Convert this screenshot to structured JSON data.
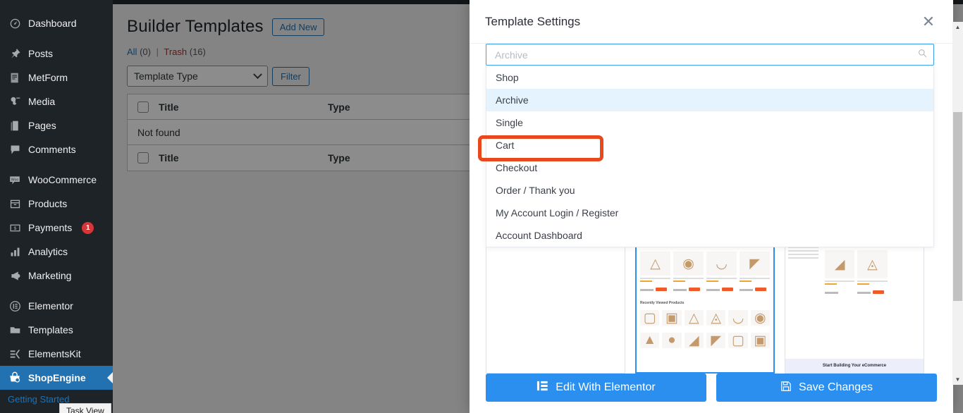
{
  "sidebar": {
    "items": [
      {
        "label": "Dashboard",
        "icon": "dashboard-icon",
        "gap_after": true
      },
      {
        "label": "Posts",
        "icon": "pin-icon",
        "gap_after": false
      },
      {
        "label": "MetForm",
        "icon": "form-icon",
        "gap_after": false
      },
      {
        "label": "Media",
        "icon": "media-icon",
        "gap_after": false
      },
      {
        "label": "Pages",
        "icon": "pages-icon",
        "gap_after": false
      },
      {
        "label": "Comments",
        "icon": "comment-icon",
        "gap_after": true
      },
      {
        "label": "WooCommerce",
        "icon": "woo-icon",
        "gap_after": false
      },
      {
        "label": "Products",
        "icon": "products-icon",
        "gap_after": false
      },
      {
        "label": "Payments",
        "icon": "payments-icon",
        "badge": "1",
        "gap_after": false
      },
      {
        "label": "Analytics",
        "icon": "analytics-icon",
        "gap_after": false
      },
      {
        "label": "Marketing",
        "icon": "marketing-icon",
        "gap_after": true
      },
      {
        "label": "Elementor",
        "icon": "elementor-icon",
        "gap_after": false
      },
      {
        "label": "Templates",
        "icon": "templates-icon",
        "gap_after": false
      },
      {
        "label": "ElementsKit",
        "icon": "elementskit-icon",
        "gap_after": false
      },
      {
        "label": "ShopEngine",
        "icon": "shopengine-icon",
        "active": true,
        "gap_after": false
      }
    ],
    "submenu_label": "Getting Started"
  },
  "taskview_tooltip": "Task View",
  "page": {
    "title": "Builder Templates",
    "add_new_label": "Add New",
    "views": {
      "all_label": "All",
      "all_count": "(0)",
      "separator": "|",
      "trash_label": "Trash",
      "trash_count": "(16)"
    },
    "filter": {
      "select_value": "Template Type",
      "button_label": "Filter"
    },
    "table": {
      "columns": {
        "title": "Title",
        "type": "Type"
      },
      "empty_message": "Not found"
    }
  },
  "modal": {
    "title": "Template Settings",
    "close_label": "✕",
    "search": {
      "value": "",
      "placeholder": "Archive"
    },
    "dropdown": {
      "options": [
        "Shop",
        "Archive",
        "Single",
        "Cart",
        "Checkout",
        "Order / Thank you",
        "My Account Login / Register",
        "Account Dashboard"
      ],
      "selected": "Archive"
    },
    "footer": {
      "edit_label": "Edit With Elementor",
      "save_label": "Save Changes"
    }
  },
  "colors": {
    "accent_blue": "#2a8fef",
    "wp_blue": "#2271b1",
    "sidebar_bg": "#1d2327",
    "annotation_orange": "#e8491c",
    "highlight_row": "#e4f3fd",
    "badge_red": "#d63638"
  }
}
